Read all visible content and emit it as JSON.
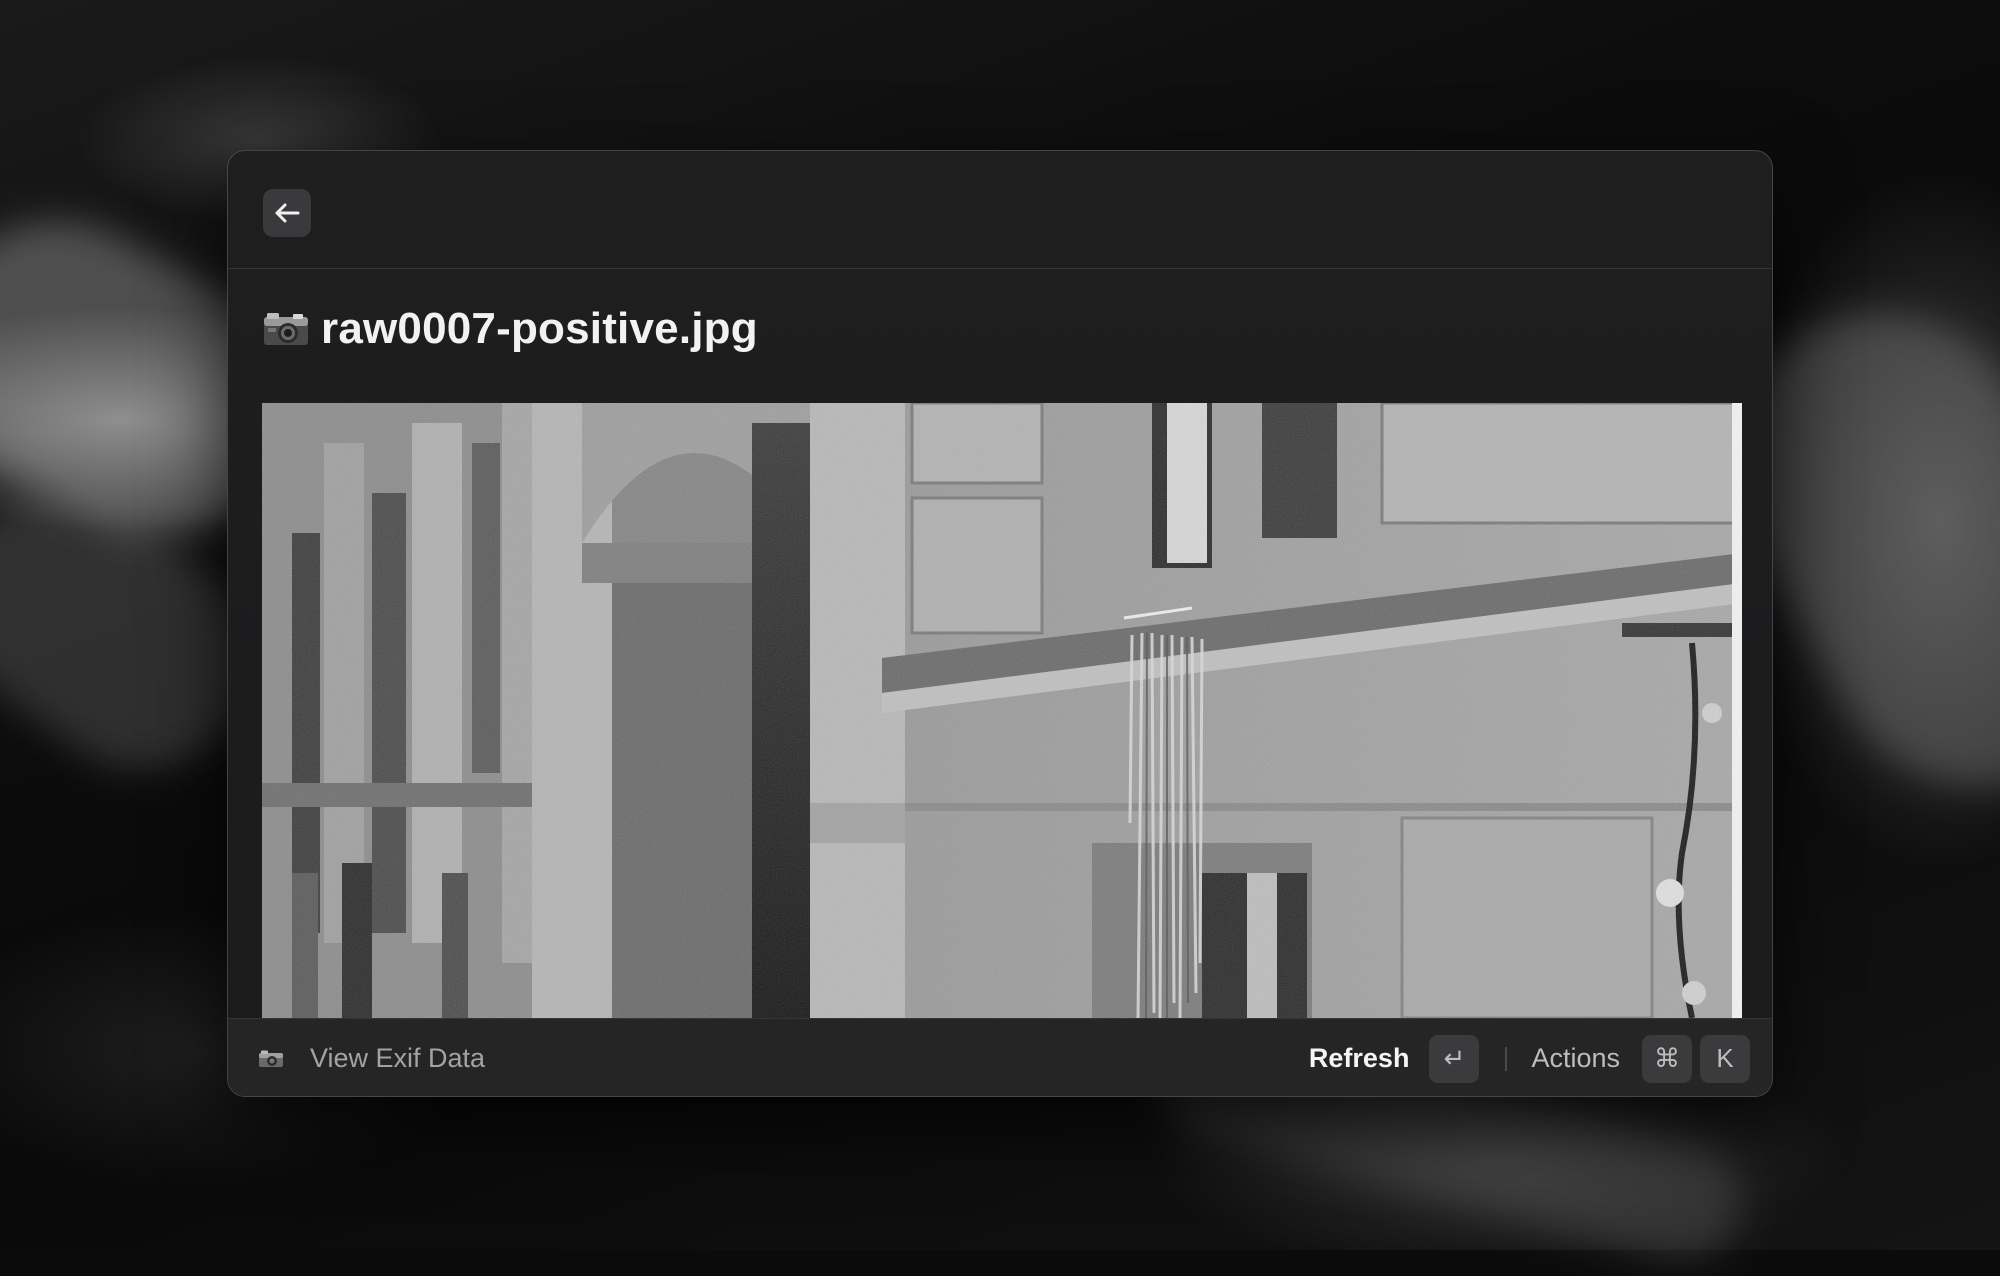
{
  "window": {
    "back_icon": "arrow-left-icon",
    "title_icon": "camera-with-flash-icon",
    "title": "raw0007-positive.jpg",
    "preview_description_icon": "photo-preview"
  },
  "footer": {
    "action_icon": "camera-icon",
    "primary_action_label": "View Exif Data",
    "refresh_label": "Refresh",
    "refresh_key": "↵",
    "actions_label": "Actions",
    "actions_key_modifier": "⌘",
    "actions_key": "K"
  },
  "colors": {
    "window_bg": "#1e1e1f",
    "footer_bg": "#252526",
    "key_bg": "#3b3b3d",
    "text_primary": "#f2f2f2",
    "text_secondary": "#a3a3a3"
  }
}
